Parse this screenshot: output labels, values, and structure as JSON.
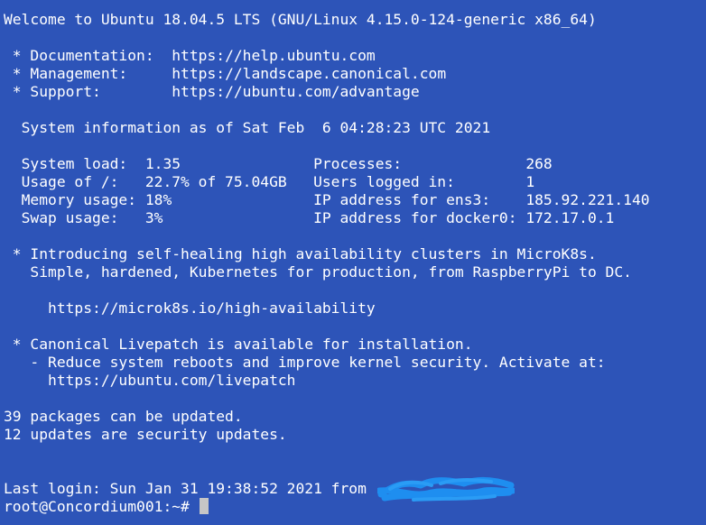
{
  "colors": {
    "background": "#2d54b8",
    "text": "#ffffff",
    "cursor": "#c6c6c6",
    "redaction": "#1e8ef0"
  },
  "motd": {
    "welcome": "Welcome to Ubuntu 18.04.5 LTS (GNU/Linux 4.15.0-124-generic x86_64)",
    "links": [
      {
        "label": " * Documentation:  ",
        "url": "https://help.ubuntu.com"
      },
      {
        "label": " * Management:     ",
        "url": "https://landscape.canonical.com"
      },
      {
        "label": " * Support:        ",
        "url": "https://ubuntu.com/advantage"
      }
    ],
    "sysinfo_header": "  System information as of Sat Feb  6 04:28:23 UTC 2021",
    "sysinfo_rows": [
      "  System load:  1.35               Processes:              268",
      "  Usage of /:   22.7% of 75.04GB   Users logged in:        1",
      "  Memory usage: 18%                IP address for ens3:    185.92.221.140",
      "  Swap usage:   3%                 IP address for docker0: 172.17.0.1"
    ],
    "microk8s_lines": [
      " * Introducing self-healing high availability clusters in MicroK8s.",
      "   Simple, hardened, Kubernetes for production, from RaspberryPi to DC."
    ],
    "microk8s_url": "     https://microk8s.io/high-availability",
    "livepatch_lines": [
      " * Canonical Livepatch is available for installation.",
      "   - Reduce system reboots and improve kernel security. Activate at:"
    ],
    "livepatch_url": "     https://ubuntu.com/livepatch",
    "updates_lines": [
      "39 packages can be updated.",
      "12 updates are security updates."
    ],
    "last_login": "Last login: Sun Jan 31 19:38:52 2021 from",
    "prompt": "root@Concordium001:~# "
  }
}
